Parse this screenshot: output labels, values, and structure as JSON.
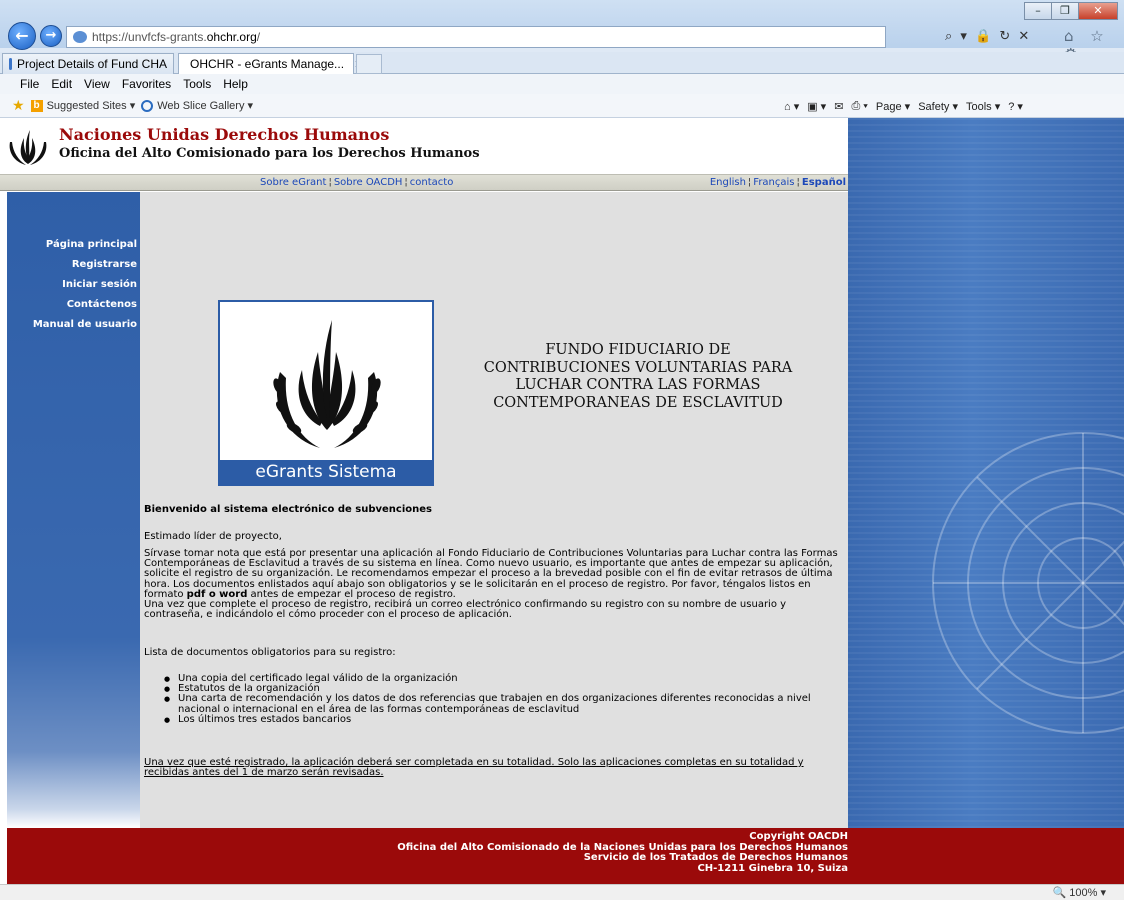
{
  "browser": {
    "url_prefix": "https://unvfcfs-grants.",
    "url_domain": "ohchr.org",
    "url_suffix": "/",
    "address_tools": "⌕ ▾ 🔒 ↻ ✕",
    "fav_tools": "⌂ ☆ ⚙",
    "tabs": [
      {
        "label": "Project Details of Fund CHA"
      },
      {
        "label": "OHCHR - eGrants Manage...",
        "close": "✕"
      }
    ],
    "menu": [
      "File",
      "Edit",
      "View",
      "Favorites",
      "Tools",
      "Help"
    ],
    "favorites": [
      {
        "label": "Suggested Sites ▾"
      },
      {
        "label": "Web Slice Gallery ▾"
      }
    ],
    "command_bar": [
      "⌂ ▾",
      "▣ ▾",
      "✉",
      "⎙ ▾",
      "Page ▾",
      "Safety ▾",
      "Tools ▾",
      "? ▾"
    ],
    "window_buttons": [
      "–",
      "❐",
      "✕"
    ],
    "zoom": "100%  ▾"
  },
  "header": {
    "title": "Naciones Unidas Derechos Humanos",
    "subtitle": "Oficina del Alto Comisionado para los Derechos Humanos"
  },
  "top_links": [
    "Sobre eGrant",
    "Sobre OACDH",
    "contacto"
  ],
  "lang_links": [
    "English",
    "Français",
    "Español"
  ],
  "link_separator": "¦",
  "nav": [
    "Página principal",
    "Registrarse",
    "Iniciar sesión",
    "Contáctenos",
    "Manual de usuario"
  ],
  "main": {
    "logo_label": "eGrants Sistema",
    "fund_title": "FUNDO FIDUCIARIO DE CONTRIBUCIONES VOLUNTARIAS PARA LUCHAR CONTRA LAS FORMAS CONTEMPORANEAS DE ESCLAVITUD",
    "welcome": "Bienvenido al sistema electrónico de subvenciones",
    "greeting": "Estimado líder de proyecto,",
    "para1_a": "Sírvase tomar nota que está por presentar una aplicación al Fondo Fiduciario de Contribuciones Voluntarias para Luchar contra las Formas Contemporáneas de Esclavitud a través de su sistema en línea. Como nuevo usuario, es importante que antes de empezar su aplicación, solicite el registro de su organización. Le recomendamos empezar el proceso a la brevedad posible con el fin de evitar retrasos de última hora. Los documentos enlistados aquí abajo son obligatorios y se le solicitarán en el proceso de registro. Por favor, téngalos listos en formato ",
    "para1_bold": "pdf o word",
    "para1_b": " antes de empezar el proceso de registro.",
    "para1_c": "Una vez que complete el proceso de registro, recibirá un correo electrónico confirmando su registro con su nombre de usuario y contraseña, e indicándolo el cómo proceder con el proceso de aplicación.",
    "list_title": "Lista de documentos obligatorios para su registro:",
    "documents": [
      "Una copia del certificado legal válido de la organización",
      "Estatutos de la organización",
      "Una carta de recomendación y los datos de dos referencias que trabajen en dos organizaciones diferentes reconocidas a nivel nacional o internacional en el área de las formas contemporáneas de esclavitud",
      "Los últimos tres estados bancarios"
    ],
    "final_note": "Una vez que esté registrado, la aplicación deberá ser completada en su totalidad. Solo las aplicaciones completas en su totalidad y recibidas antes del 1 de marzo serán revisadas."
  },
  "footer": {
    "line1": "Copyright OACDH",
    "line2": "Oficina del Alto Comisionado de la Naciones Unidas para los Derechos Humanos",
    "line3": "Servicio de los Tratados de Derechos Humanos",
    "line4": "CH-1211 Ginebra 10, Suiza"
  }
}
